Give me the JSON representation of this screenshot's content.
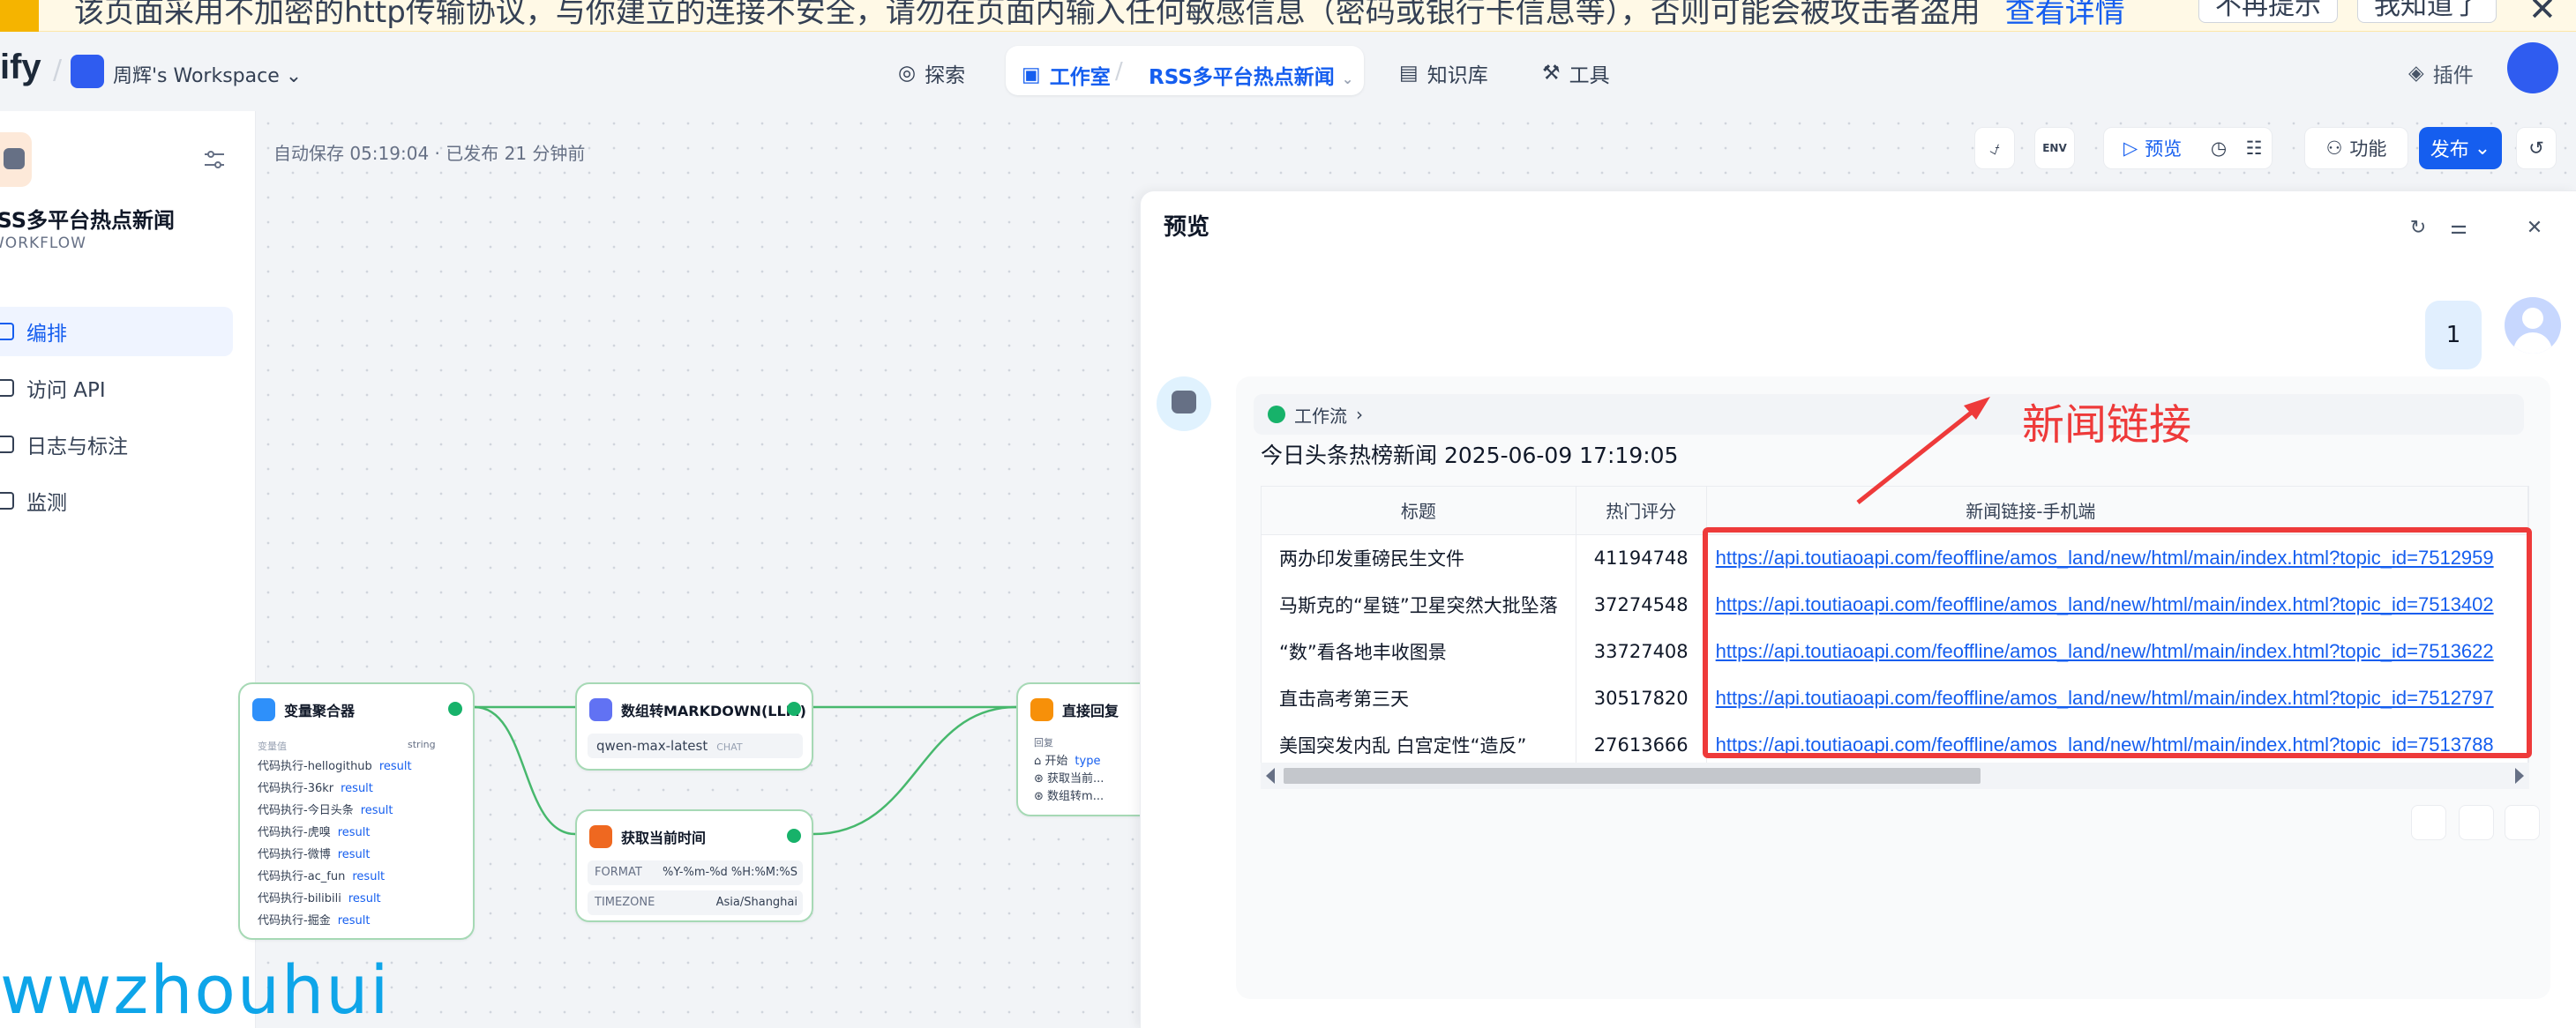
{
  "banner": {
    "message": "该页面采用不加密的http传输协议，与你建立的连接不安全，请勿在页面内输入任何敏感信息（密码或银行卡信息等），否则可能会被攻击者盗用",
    "link_label": "查看详情",
    "no_remind_label": "不再提示",
    "got_it_label": "我知道了"
  },
  "header": {
    "logo": "ify",
    "workspace": "周辉's Workspace",
    "nav": {
      "explore": "探索",
      "studio": "工作室",
      "app": "RSS多平台热点新闻",
      "knowledge": "知识库",
      "tools": "工具"
    },
    "plugins": "插件"
  },
  "sidebar": {
    "app_name": "RSS多平台热点新闻",
    "app_type": "WORKFLOW",
    "items": [
      {
        "label": "编排"
      },
      {
        "label": "访问 API"
      },
      {
        "label": "日志与标注"
      },
      {
        "label": "监测"
      }
    ]
  },
  "canvas": {
    "autosave": "自动保存 05:19:04 · 已发布 21 分钟前",
    "toolbar": {
      "env_label": "ENV",
      "preview": "预览",
      "features": "功能",
      "publish": "发布"
    }
  },
  "nodes": {
    "aggregator": {
      "title": "变量聚合器",
      "type_label": "string",
      "rows": [
        "代码执行-hellogithub",
        "代码执行-36kr",
        "代码执行-今日头条",
        "代码执行-虎嗅",
        "代码执行-微博",
        "代码执行-ac_fun",
        "代码执行-bilibili",
        "代码执行-掘金"
      ],
      "var": "result"
    },
    "llm": {
      "title": "数组转MARKDOWN(LLM)",
      "model": "qwen-max-latest",
      "badge": "CHAT"
    },
    "time": {
      "title": "获取当前时间",
      "format_label": "FORMAT",
      "format": "%Y-%m-%d %H:%M:%S",
      "tz_label": "TIMEZONE",
      "tz": "Asia/Shanghai"
    },
    "answer": {
      "title": "直接回复",
      "reply_label": "回复",
      "rows": [
        "开始",
        "获取当前...",
        "数组转m..."
      ],
      "var": "type"
    }
  },
  "preview": {
    "title": "预览",
    "user_message": "1",
    "workflow_label": "工作流",
    "news_title": "今日头条热榜新闻 2025-06-09 17:19:05",
    "table": {
      "headers": [
        "标题",
        "热门评分",
        "新闻链接-手机端"
      ],
      "rows": [
        [
          "两办印发重磅民生文件",
          "41194748",
          "https://api.toutiaoapi.com/feoffline/amos_land/new/html/main/index.html?topic_id=7512959"
        ],
        [
          "马斯克的“星链”卫星突然大批坠落",
          "37274548",
          "https://api.toutiaoapi.com/feoffline/amos_land/new/html/main/index.html?topic_id=7513402"
        ],
        [
          "“数”看各地丰收图景",
          "33727408",
          "https://api.toutiaoapi.com/feoffline/amos_land/new/html/main/index.html?topic_id=7513622"
        ],
        [
          "直击高考第三天",
          "30517820",
          "https://api.toutiaoapi.com/feoffline/amos_land/new/html/main/index.html?topic_id=7512797"
        ],
        [
          "美国突发内乱 白宫定性“造反”",
          "27613666",
          "https://api.toutiaoapi.com/feoffline/amos_land/new/html/main/index.html?topic_id=7513788"
        ]
      ]
    }
  },
  "annotation": {
    "label": "新闻链接",
    "color": "#ee3a3a"
  },
  "watermark": "wwzhouhui"
}
